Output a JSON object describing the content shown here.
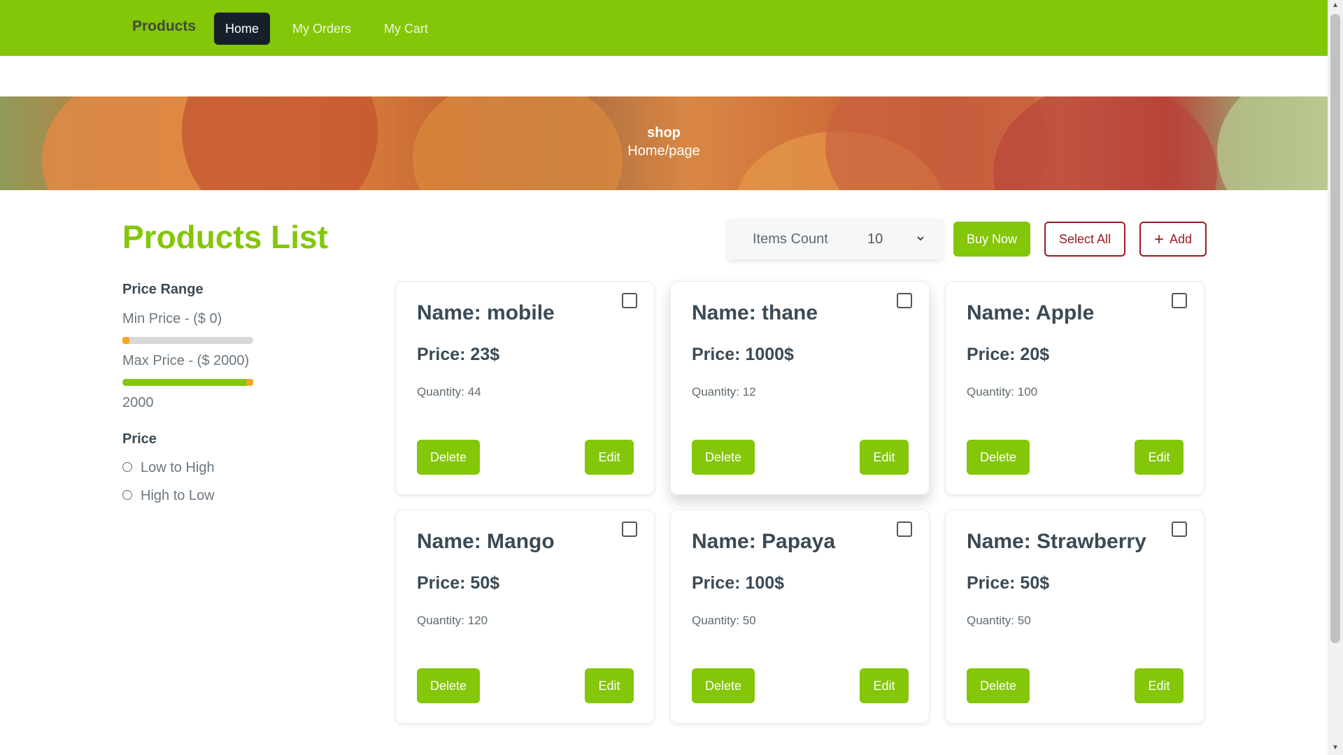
{
  "nav": {
    "brand": "Products",
    "items": [
      {
        "label": "Home",
        "active": true
      },
      {
        "label": "My Orders",
        "active": false
      },
      {
        "label": "My Cart",
        "active": false
      }
    ]
  },
  "banner": {
    "title": "shop",
    "breadcrumb": "Home/page"
  },
  "main": {
    "title": "Products List",
    "items_count_label": "Items Count",
    "items_count_value": "10",
    "buy_now_label": "Buy Now",
    "select_all_label": "Select All",
    "add_label": "Add"
  },
  "sidebar": {
    "price_range_heading": "Price Range",
    "min_price_label": "Min Price - ($ 0)",
    "min_price_level": 0,
    "max_price_label": "Max Price - ($ 2000)",
    "max_price_level": 1,
    "max_price_value": "2000",
    "sort_heading": "Price",
    "sort_options": [
      "Low to High",
      "High to Low"
    ]
  },
  "products": [
    {
      "name": "Name: mobile",
      "price": "Price: 23$",
      "quantity": "Quantity: 44",
      "delete_label": "Delete",
      "edit_label": "Edit"
    },
    {
      "name": "Name: thane",
      "price": "Price: 1000$",
      "quantity": "Quantity: 12",
      "delete_label": "Delete",
      "edit_label": "Edit"
    },
    {
      "name": "Name: Apple",
      "price": "Price: 20$",
      "quantity": "Quantity: 100",
      "delete_label": "Delete",
      "edit_label": "Edit"
    },
    {
      "name": "Name: Mango",
      "price": "Price: 50$",
      "quantity": "Quantity: 120",
      "delete_label": "Delete",
      "edit_label": "Edit"
    },
    {
      "name": "Name: Papaya",
      "price": "Price: 100$",
      "quantity": "Quantity: 50",
      "delete_label": "Delete",
      "edit_label": "Edit"
    },
    {
      "name": "Name: Strawberry",
      "price": "Price: 50$",
      "quantity": "Quantity: 50",
      "delete_label": "Delete",
      "edit_label": "Edit"
    }
  ],
  "colors": {
    "accent": "#84c608",
    "danger": "#9b1c22",
    "dark": "#16202a",
    "slider_thumb": "#f5a623"
  }
}
